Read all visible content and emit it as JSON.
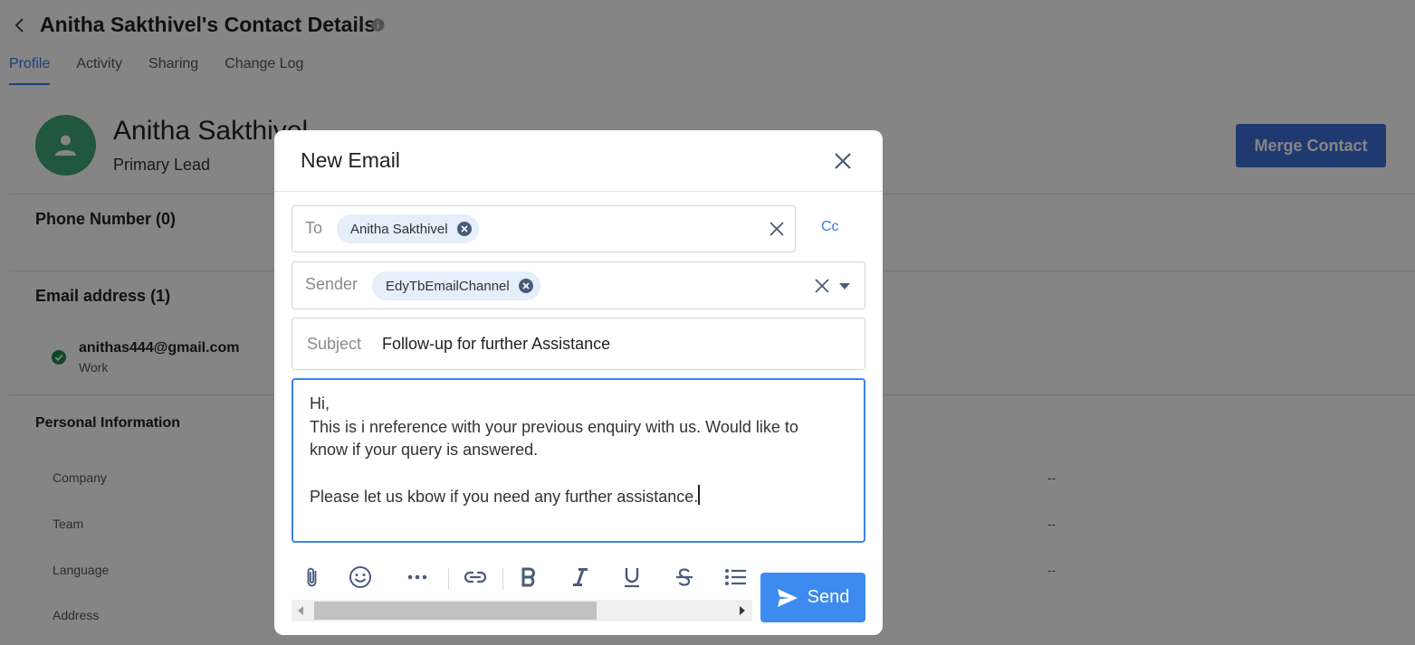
{
  "page": {
    "title": "Anitha Sakthivel's Contact Details",
    "tabs": [
      {
        "label": "Profile",
        "active": true
      },
      {
        "label": "Activity",
        "active": false
      },
      {
        "label": "Sharing",
        "active": false
      },
      {
        "label": "Change Log",
        "active": false
      }
    ]
  },
  "contact": {
    "name": "Anitha Sakthivel",
    "role": "Primary Lead",
    "merge_label": "Merge Contact",
    "phone_heading": "Phone Number (0)",
    "email_heading": "Email address (1)",
    "email": {
      "value": "anithas444@gmail.com",
      "type": "Work"
    },
    "personal_heading": "Personal Information",
    "personal_fields": [
      {
        "label": "Company",
        "value": "--"
      },
      {
        "label": "Team",
        "value": "--"
      },
      {
        "label": "Language",
        "value": "--"
      },
      {
        "label": "Address",
        "value": ""
      }
    ]
  },
  "modal": {
    "title": "New Email",
    "to": {
      "label": "To",
      "chips": [
        "Anitha Sakthivel"
      ]
    },
    "cc_label": "Cc",
    "sender": {
      "label": "Sender",
      "chips": [
        "EdyTbEmailChannel"
      ]
    },
    "subject": {
      "label": "Subject",
      "value": "Follow-up for further Assistance"
    },
    "body_lines": [
      "Hi,",
      "This is i nreference with your previous enquiry with us. Would like to",
      "know if your query is answered.",
      "",
      "Please let us kbow if you need any further assistance."
    ],
    "send_label": "Send"
  },
  "colors": {
    "accent": "#3b78e7",
    "send_button": "#3d8af0",
    "merge_button": "#3a6fd8",
    "avatar": "#3fa776",
    "verified": "#1f8a4c",
    "chip_bg": "#e5eef9",
    "toolbar_icon": "#4a5b7a"
  },
  "icons": {
    "back": "chevron-left-icon",
    "info": "info-icon",
    "avatar": "person-icon",
    "verified": "check-circle-icon",
    "close": "close-icon",
    "chip_remove": "remove-circle-icon",
    "dropdown": "caret-down-icon",
    "toolbar": [
      "paperclip-icon",
      "emoji-icon",
      "more-icon",
      "link-icon",
      "bold-icon",
      "italic-icon",
      "underline-icon",
      "strikethrough-icon",
      "bullet-list-icon"
    ],
    "send": "send-icon"
  }
}
